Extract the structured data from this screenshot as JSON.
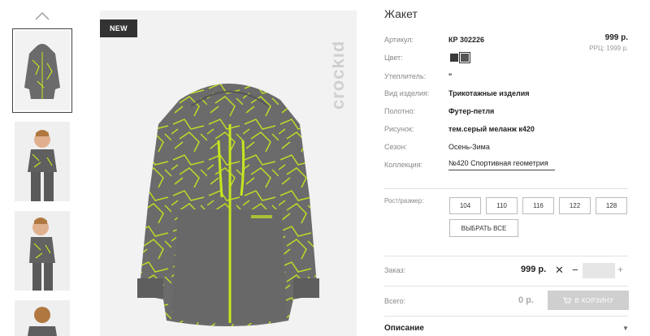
{
  "product": {
    "title": "Жакет",
    "badge": "NEW",
    "brand": "crockid",
    "price": "999 р.",
    "rrp": "РРЦ: 1999 р."
  },
  "attributes": [
    {
      "label": "Артикул:",
      "value": "КР 302226"
    },
    {
      "label": "Цвет:",
      "value": ""
    },
    {
      "label": "Утеплитель:",
      "value": "\""
    },
    {
      "label": "Вид изделия:",
      "value": "Трикотажные изделия"
    },
    {
      "label": "Полотно:",
      "value": "Футер-петля"
    },
    {
      "label": "Рисунок:",
      "value": "тем.серый меланж к420"
    },
    {
      "label": "Сезон:",
      "value": "Осень-Зима"
    },
    {
      "label": "Коллекция:",
      "value": "№420 Спортивная геометрия"
    }
  ],
  "colors": [
    "#3a3a3a",
    "#555555"
  ],
  "sizes": {
    "label": "Рост/размер:",
    "options": [
      "104",
      "110",
      "116",
      "122",
      "128"
    ],
    "select_all": "ВЫБРАТЬ ВСЕ"
  },
  "order": {
    "label": "Заказ:",
    "price": "999 р.",
    "remove": "✕",
    "minus": "−",
    "plus": "+",
    "quantity": ""
  },
  "total": {
    "label": "Всего:",
    "price": "0 р.",
    "cart_button": "В КОРЗИНУ"
  },
  "description": {
    "label": "Описание",
    "chevron": "▼"
  },
  "theme": {
    "jacket_gray": "#6b6b6b",
    "accent_lime": "#c8e61e",
    "cart_disabled": "#cfcfcf"
  }
}
